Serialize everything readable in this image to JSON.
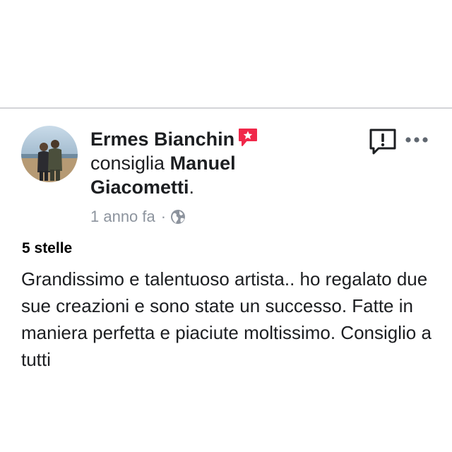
{
  "post": {
    "author": "Ermes Bianchin",
    "action": "consiglia",
    "page_name_part1": "Manuel",
    "page_name_part2": "Giacometti",
    "punctuation": ".",
    "timestamp": "1 anno fa",
    "separator": "·",
    "rating": "5 stelle",
    "review_text": "Grandissimo e talentuoso artista.. ho regalato due sue creazioni e sono state un successo. Fatte in maniera perfetta e piaciute moltissimo. Consiglio a tutti"
  },
  "icons": {
    "recommend": "recommend-star-bubble-icon",
    "privacy": "globe-icon",
    "report": "report-exclamation-icon",
    "more": "more-dots-icon"
  },
  "colors": {
    "recommend_red": "#f0284a",
    "meta_gray": "#8d949e",
    "text": "#1c1e21"
  }
}
